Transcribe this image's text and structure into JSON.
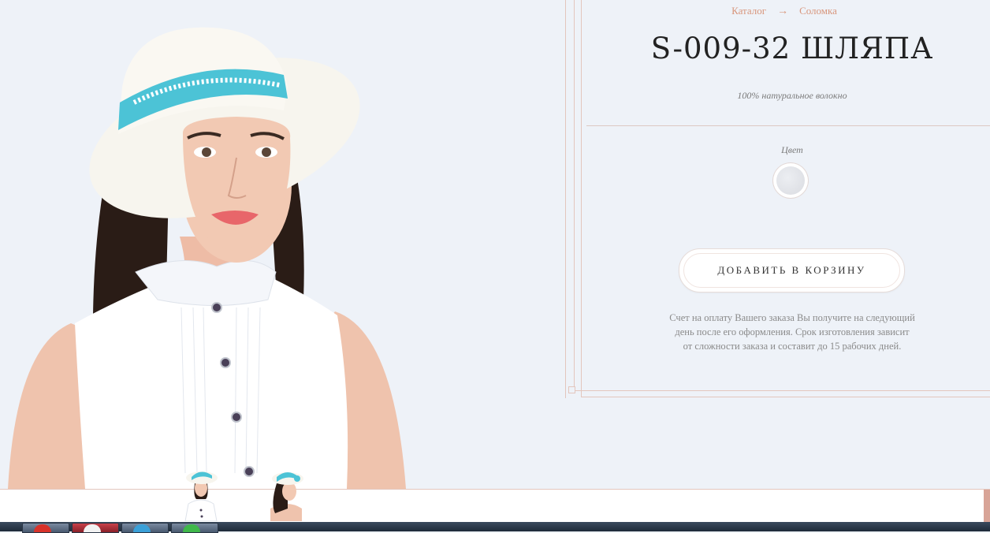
{
  "breadcrumb": {
    "catalog": "Каталог",
    "arrow": "→",
    "current": "Соломка"
  },
  "product": {
    "title": "S-009-32 ШЛЯПА",
    "material": "100% натуральное волокно",
    "color_label": "Цвет",
    "swatch_color": "#dfe1e6"
  },
  "cart": {
    "button_label": "ДОБАВИТЬ В КОРЗИНУ"
  },
  "note": {
    "lines": [
      "Счет на оплату Вашего заказа Вы получите на следующий",
      "день после его оформления. Срок изготовления зависит",
      "от сложности заказа и составит до 15 рабочих дней."
    ]
  },
  "colors": {
    "accent": "#d8967c",
    "frame": "#e3c6bd",
    "background": "#eef2f8",
    "hat_band": "#4cc3d6"
  },
  "thumbnails": [
    "front-view",
    "side-view"
  ]
}
